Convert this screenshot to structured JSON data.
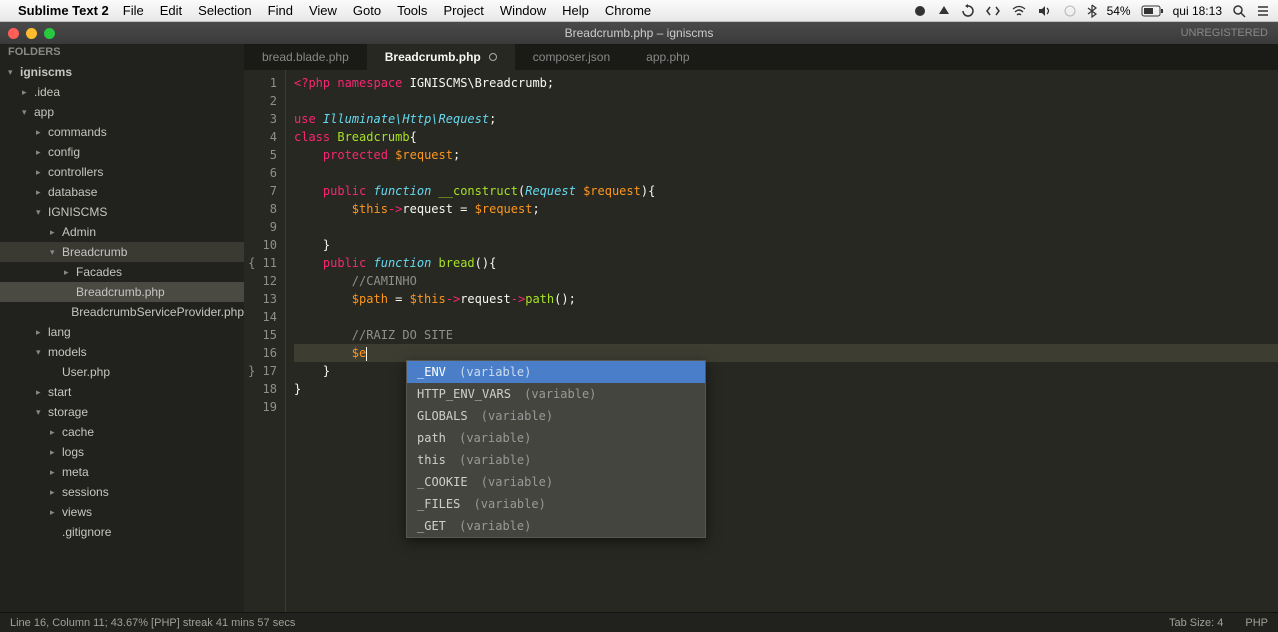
{
  "menubar": {
    "app_name": "Sublime Text 2",
    "items": [
      "File",
      "Edit",
      "Selection",
      "Find",
      "View",
      "Goto",
      "Tools",
      "Project",
      "Window",
      "Help",
      "Chrome"
    ],
    "right": {
      "battery": "54%",
      "clock": "qui 18:13"
    }
  },
  "window": {
    "title": "Breadcrumb.php  –  igniscms",
    "unregistered": "UNREGISTERED"
  },
  "sidebar": {
    "header": "FOLDERS",
    "tree": [
      {
        "indent": 0,
        "arrow": "down",
        "label": "igniscms",
        "bold": true
      },
      {
        "indent": 1,
        "arrow": "right",
        "label": ".idea"
      },
      {
        "indent": 1,
        "arrow": "down",
        "label": "app"
      },
      {
        "indent": 2,
        "arrow": "right",
        "label": "commands"
      },
      {
        "indent": 2,
        "arrow": "right",
        "label": "config"
      },
      {
        "indent": 2,
        "arrow": "right",
        "label": "controllers"
      },
      {
        "indent": 2,
        "arrow": "right",
        "label": "database"
      },
      {
        "indent": 2,
        "arrow": "down",
        "label": "IGNISCMS"
      },
      {
        "indent": 3,
        "arrow": "right",
        "label": "Admin"
      },
      {
        "indent": 3,
        "arrow": "down",
        "label": "Breadcrumb",
        "selected": true
      },
      {
        "indent": 4,
        "arrow": "right",
        "label": "Facades"
      },
      {
        "indent": 4,
        "arrow": "",
        "label": "Breadcrumb.php",
        "highlighted": true
      },
      {
        "indent": 4,
        "arrow": "",
        "label": "BreadcrumbServiceProvider.php"
      },
      {
        "indent": 2,
        "arrow": "right",
        "label": "lang"
      },
      {
        "indent": 2,
        "arrow": "down",
        "label": "models"
      },
      {
        "indent": 3,
        "arrow": "",
        "label": "User.php"
      },
      {
        "indent": 2,
        "arrow": "right",
        "label": "start"
      },
      {
        "indent": 2,
        "arrow": "down",
        "label": "storage"
      },
      {
        "indent": 3,
        "arrow": "right",
        "label": "cache"
      },
      {
        "indent": 3,
        "arrow": "right",
        "label": "logs"
      },
      {
        "indent": 3,
        "arrow": "right",
        "label": "meta"
      },
      {
        "indent": 3,
        "arrow": "right",
        "label": "sessions"
      },
      {
        "indent": 3,
        "arrow": "right",
        "label": "views"
      },
      {
        "indent": 3,
        "arrow": "",
        "label": ".gitignore"
      }
    ]
  },
  "tabs": [
    {
      "label": "bread.blade.php",
      "active": false,
      "modified": false
    },
    {
      "label": "Breadcrumb.php",
      "active": true,
      "modified": true
    },
    {
      "label": "composer.json",
      "active": false,
      "modified": false
    },
    {
      "label": "app.php",
      "active": false,
      "modified": false
    }
  ],
  "gutter": {
    "lines": [
      "1",
      "2",
      "3",
      "4",
      "5",
      "6",
      "7",
      "8",
      "9",
      "10",
      "11",
      "12",
      "13",
      "14",
      "15",
      "16",
      "17",
      "18",
      "19"
    ],
    "fold_open": [
      11
    ],
    "fold_close": [
      17
    ]
  },
  "code": {
    "l1_kw1": "<?php",
    "l1_kw2": "namespace",
    "l1_ns": "IGNISCMS\\Breadcrumb",
    "l1_sc": ";",
    "l3_kw": "use",
    "l3_ns": "Illuminate\\Http\\Request",
    "l3_sc": ";",
    "l4_kw": "class",
    "l4_name": "Breadcrumb",
    "l4_ob": "{",
    "l5_kw": "protected",
    "l5_var": "$request",
    "l5_sc": ";",
    "l7_vis": "public",
    "l7_kw": "function",
    "l7_name": "__construct",
    "l7_op": "(",
    "l7_type": "Request",
    "l7_param": "$request",
    "l7_cp": ")",
    "l7_ob": "{",
    "l8_this": "$this",
    "l8_arrow": "->",
    "l8_prop": "request",
    "l8_eq": " = ",
    "l8_var": "$request",
    "l8_sc": ";",
    "l10_cb": "}",
    "l11_vis": "public",
    "l11_kw": "function",
    "l11_name": "bread",
    "l11_parens": "()",
    "l11_ob": "{",
    "l12_com": "//CAMINHO",
    "l13_var": "$path",
    "l13_eq": " = ",
    "l13_this": "$this",
    "l13_arrow1": "->",
    "l13_prop": "request",
    "l13_arrow2": "->",
    "l13_fn": "path",
    "l13_parens": "();",
    "l15_com": "//RAIZ DO SITE",
    "l16_prefix": "$e",
    "l17_cb": "}",
    "l18_cb": "}"
  },
  "autocomplete": {
    "items": [
      {
        "name": "_ENV",
        "hint": "(variable)",
        "selected": true
      },
      {
        "name": "HTTP_ENV_VARS",
        "hint": "(variable)"
      },
      {
        "name": "GLOBALS",
        "hint": "(variable)"
      },
      {
        "name": "path",
        "hint": "(variable)"
      },
      {
        "name": "this",
        "hint": "(variable)"
      },
      {
        "name": "_COOKIE",
        "hint": "(variable)"
      },
      {
        "name": "_FILES",
        "hint": "(variable)"
      },
      {
        "name": "_GET",
        "hint": "(variable)"
      }
    ]
  },
  "statusbar": {
    "left": "Line 16, Column 11; 43.67% [PHP] streak 41 mins 57 secs",
    "tab_size": "Tab Size: 4",
    "syntax": "PHP"
  }
}
